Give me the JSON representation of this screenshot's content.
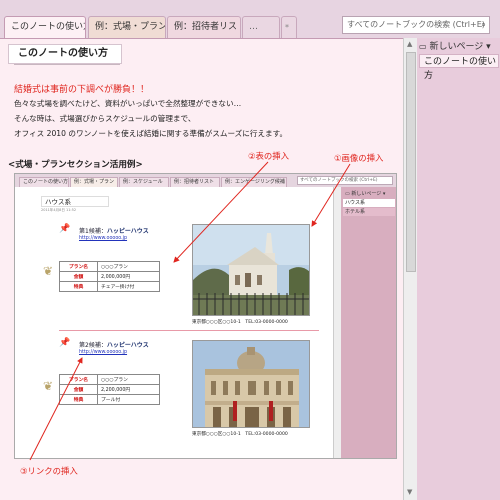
{
  "tabs": [
    {
      "label": "このノートの使い方"
    },
    {
      "label": "例：式場・プラン"
    },
    {
      "label": "例：招待者リスト"
    },
    {
      "label": "…"
    },
    {
      "label": "*"
    }
  ],
  "search": {
    "placeholder": "すべてのノートブックの検索 (Ctrl+E)"
  },
  "right_pane": {
    "new_page": "新しいページ ▾",
    "pages": [
      "このノートの使い方"
    ]
  },
  "page": {
    "title": "このノートの使い方",
    "headline": "結婚式は事前の下調べが勝負！！",
    "lines": [
      "色々な式場を調べたけど、資料がいっぱいで全然整理ができない…",
      "そんな時は、式場選びからスケジュールの管理まで、",
      "オフィス 2010 のワンノートを使えば結婚に関する準備がスムーズに行えます。"
    ],
    "section_title": "<式場・プランセクション活用例>",
    "callouts": {
      "table": "②表の挿入",
      "image": "①画像の挿入",
      "link": "③リンクの挿入"
    }
  },
  "example": {
    "tabs": [
      "このノートの使い方",
      "例：式場・プラン",
      "例：スケジュール",
      "例：招待者リスト",
      "例：エンゲージリング候補"
    ],
    "search_placeholder": "すべてのノートブックの検索 (Ctrl+E)",
    "new_page": "新しいページ",
    "pages": [
      "ハウス系",
      "ホテル系"
    ],
    "page_title": "ハウス系",
    "date": "2011年4月8日 11:52",
    "venues": [
      {
        "candidate": "第1候補：",
        "name": "ハッピーハウス",
        "url": "http://www.ooooo.jp",
        "plan_label": "プラン名",
        "plan_value": "○○○プラン",
        "price_label": "金額",
        "price_value": "2,000,000円",
        "perk_label": "特典",
        "perk_value": "チェアー掛け付",
        "address": "東京都○○○区○○10-1　TEL:03-0000-0000"
      },
      {
        "candidate": "第2候補：",
        "name": "ハッピーハウス",
        "url": "http://www.ooooo.jp",
        "plan_label": "プラン名",
        "plan_value": "○○○プラン",
        "price_label": "金額",
        "price_value": "2,200,000円",
        "perk_label": "特典",
        "perk_value": "プール付",
        "address": "東京都○○○区○○10-1　TEL:03-0000-0000"
      }
    ]
  },
  "colors": {
    "accent_red": "#e0261f",
    "tab_active": "#fdf1f5",
    "page_bg": "#fdeef3",
    "pane_pink": "#e8ccdc"
  }
}
